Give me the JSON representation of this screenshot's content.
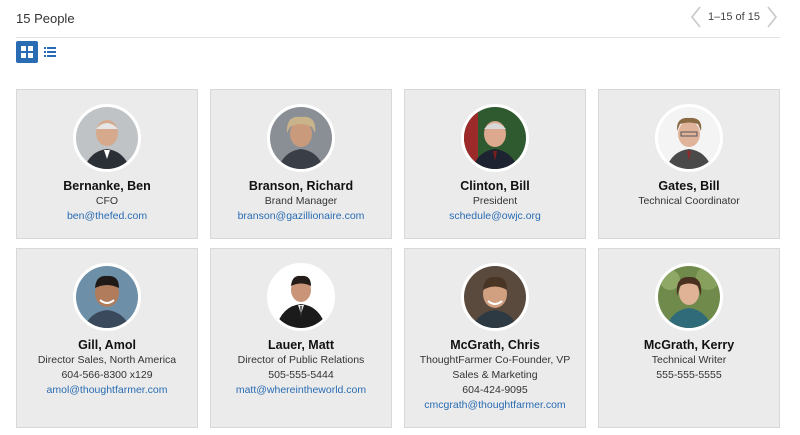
{
  "header": {
    "count_label": "15 People",
    "pager_label": "1–15 of 15"
  },
  "colors": {
    "accent": "#2a6cb3",
    "card_bg": "#ebebeb",
    "link": "#2a6cb3"
  },
  "people": [
    {
      "name": "Bernanke, Ben",
      "lines": [
        "CFO"
      ],
      "email": "ben@thefed.com"
    },
    {
      "name": "Branson, Richard",
      "lines": [
        "Brand Manager"
      ],
      "email": "branson@gazillionaire.com"
    },
    {
      "name": "Clinton, Bill",
      "lines": [
        "President"
      ],
      "email": "schedule@owjc.org"
    },
    {
      "name": "Gates, Bill",
      "lines": [
        "Technical Coordinator"
      ],
      "email": ""
    },
    {
      "name": "Gill, Amol",
      "lines": [
        "Director Sales, North America",
        "604-566-8300 x129"
      ],
      "email": "amol@thoughtfarmer.com"
    },
    {
      "name": "Lauer, Matt",
      "lines": [
        "Director of Public Relations",
        "505-555-5444"
      ],
      "email": "matt@whereintheworld.com"
    },
    {
      "name": "McGrath, Chris",
      "lines": [
        "ThoughtFarmer Co-Founder, VP",
        "Sales & Marketing",
        "604-424-9095"
      ],
      "email": "cmcgrath@thoughtfarmer.com"
    },
    {
      "name": "McGrath, Kerry",
      "lines": [
        "Technical Writer",
        "555-555-5555"
      ],
      "email": ""
    }
  ]
}
